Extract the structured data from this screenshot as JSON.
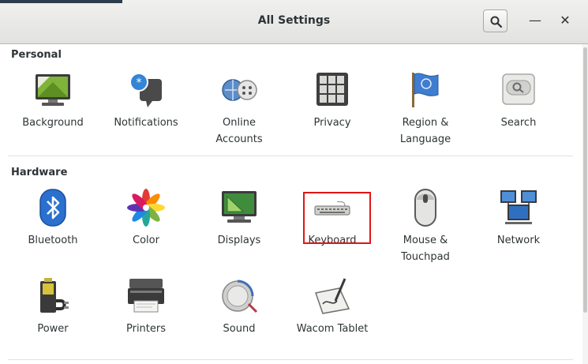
{
  "window": {
    "title": "All Settings"
  },
  "titlebar": {
    "minimize_glyph": "—",
    "close_glyph": "✕"
  },
  "sections": [
    {
      "title": "Personal",
      "items": [
        {
          "label": "Background",
          "icon": "background-icon"
        },
        {
          "label": "Notifications",
          "icon": "notifications-icon"
        },
        {
          "label": "Online\nAccounts",
          "icon": "online-accounts-icon"
        },
        {
          "label": "Privacy",
          "icon": "privacy-icon"
        },
        {
          "label": "Region &\nLanguage",
          "icon": "region-flag-icon"
        },
        {
          "label": "Search",
          "icon": "search-settings-icon"
        }
      ]
    },
    {
      "title": "Hardware",
      "items": [
        {
          "label": "Bluetooth",
          "icon": "bluetooth-icon"
        },
        {
          "label": "Color",
          "icon": "color-icon"
        },
        {
          "label": "Displays",
          "icon": "displays-icon"
        },
        {
          "label": "Keyboard",
          "icon": "keyboard-icon"
        },
        {
          "label": "Mouse &\nTouchpad",
          "icon": "mouse-icon"
        },
        {
          "label": "Network",
          "icon": "network-icon"
        },
        {
          "label": "Power",
          "icon": "power-icon"
        },
        {
          "label": "Printers",
          "icon": "printer-icon"
        },
        {
          "label": "Sound",
          "icon": "sound-icon"
        },
        {
          "label": "Wacom Tablet",
          "icon": "wacom-tablet-icon"
        }
      ]
    }
  ],
  "highlighted_item": "Keyboard",
  "colors": {
    "highlight": "#e01616"
  }
}
